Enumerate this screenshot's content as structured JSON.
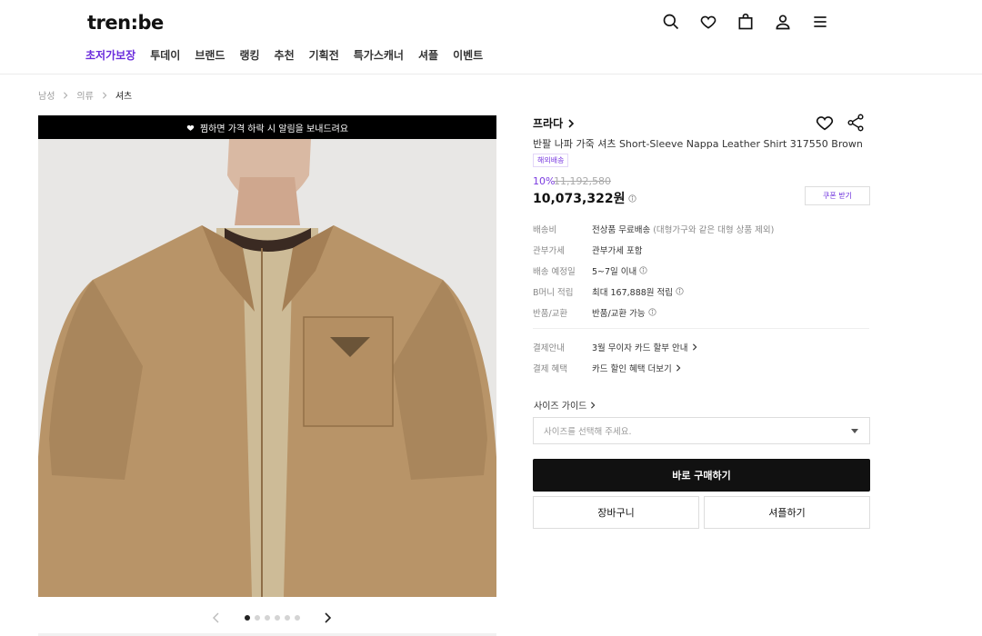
{
  "header": {
    "logo": "tren:be",
    "icons": [
      "search-icon",
      "heart-icon",
      "bag-icon",
      "user-icon",
      "menu-icon"
    ]
  },
  "nav": {
    "items": [
      "초저가보장",
      "투데이",
      "브랜드",
      "랭킹",
      "추천",
      "기획전",
      "특가스캐너",
      "셔플",
      "이벤트"
    ],
    "active_index": 0
  },
  "breadcrumb": [
    "남성",
    "의류",
    "셔츠"
  ],
  "image": {
    "banner": "찜하면 가격 하락 시 알림을 보내드려요",
    "slides": 6,
    "active_slide": 0
  },
  "product": {
    "brand": "프라다",
    "name": "반팔 나파 가죽 셔츠 Short-Sleeve Nappa Leather Shirt 317550 Brown",
    "badge": "해외배송",
    "discount": "10%",
    "original_price": "11,192,580",
    "final_price": "10,073,322원",
    "coupon_label": "쿠폰 받기"
  },
  "info": {
    "shipping_label": "배송비",
    "shipping_value": "전상품 무료배송",
    "shipping_note": "(대형가구와 같은 대형 상품 제외)",
    "tax_label": "관부가세",
    "tax_value": "관부가세 포함",
    "delivery_label": "배송 예정일",
    "delivery_value": "5~7일 이내",
    "points_label": "B머니 적립",
    "points_value": "최대 167,888원 적립",
    "return_label": "반품/교환",
    "return_value": "반품/교환 가능",
    "payment_label": "결제안내",
    "payment_value": "3월 무이자 카드 할부 안내",
    "benefit_label": "결제 혜택",
    "benefit_value": "카드 할인 혜택 더보기"
  },
  "size": {
    "guide": "사이즈 가이드",
    "placeholder": "사이즈를 선택해 주세요."
  },
  "actions": {
    "buy": "바로 구매하기",
    "cart": "장바구니",
    "shuffle": "셔플하기"
  },
  "colors": {
    "accent": "#6a2bdc",
    "primary_button": "#111111"
  }
}
